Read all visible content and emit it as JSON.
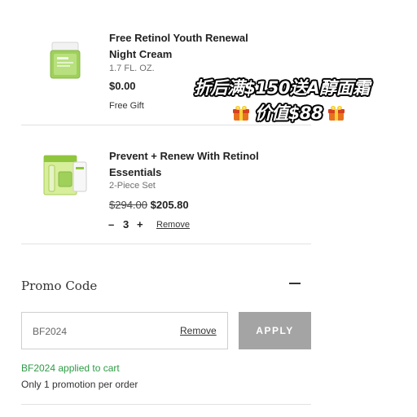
{
  "items": [
    {
      "title_line1": "Free Retinol Youth Renewal",
      "title_line2": "Night Cream",
      "size": "1.7 FL. OZ.",
      "price": "$0.00",
      "note": "Free Gift"
    },
    {
      "title_line1": "Prevent + Renew With Retinol",
      "title_line2": "Essentials",
      "size": "2-Piece Set",
      "original_price": "$294.00",
      "price": "$205.80",
      "qty_minus": "–",
      "quantity": "3",
      "qty_plus": "+",
      "remove_label": "Remove"
    }
  ],
  "overlay": {
    "line1": "折后满$150送A醇面霜",
    "line2": "价值$88",
    "icon": "gift-icon"
  },
  "promo": {
    "heading": "Promo Code",
    "toggle_icon": "minus-icon",
    "code_value": "BF2024",
    "remove_label": "Remove",
    "apply_label": "APPLY",
    "applied_message": "BF2024 applied to cart",
    "limit_message": "Only 1 promotion per order"
  },
  "colors": {
    "applied_green": "#2e9b46",
    "apply_button": "#a4a4a4",
    "jar_green": "#9fd05a"
  }
}
